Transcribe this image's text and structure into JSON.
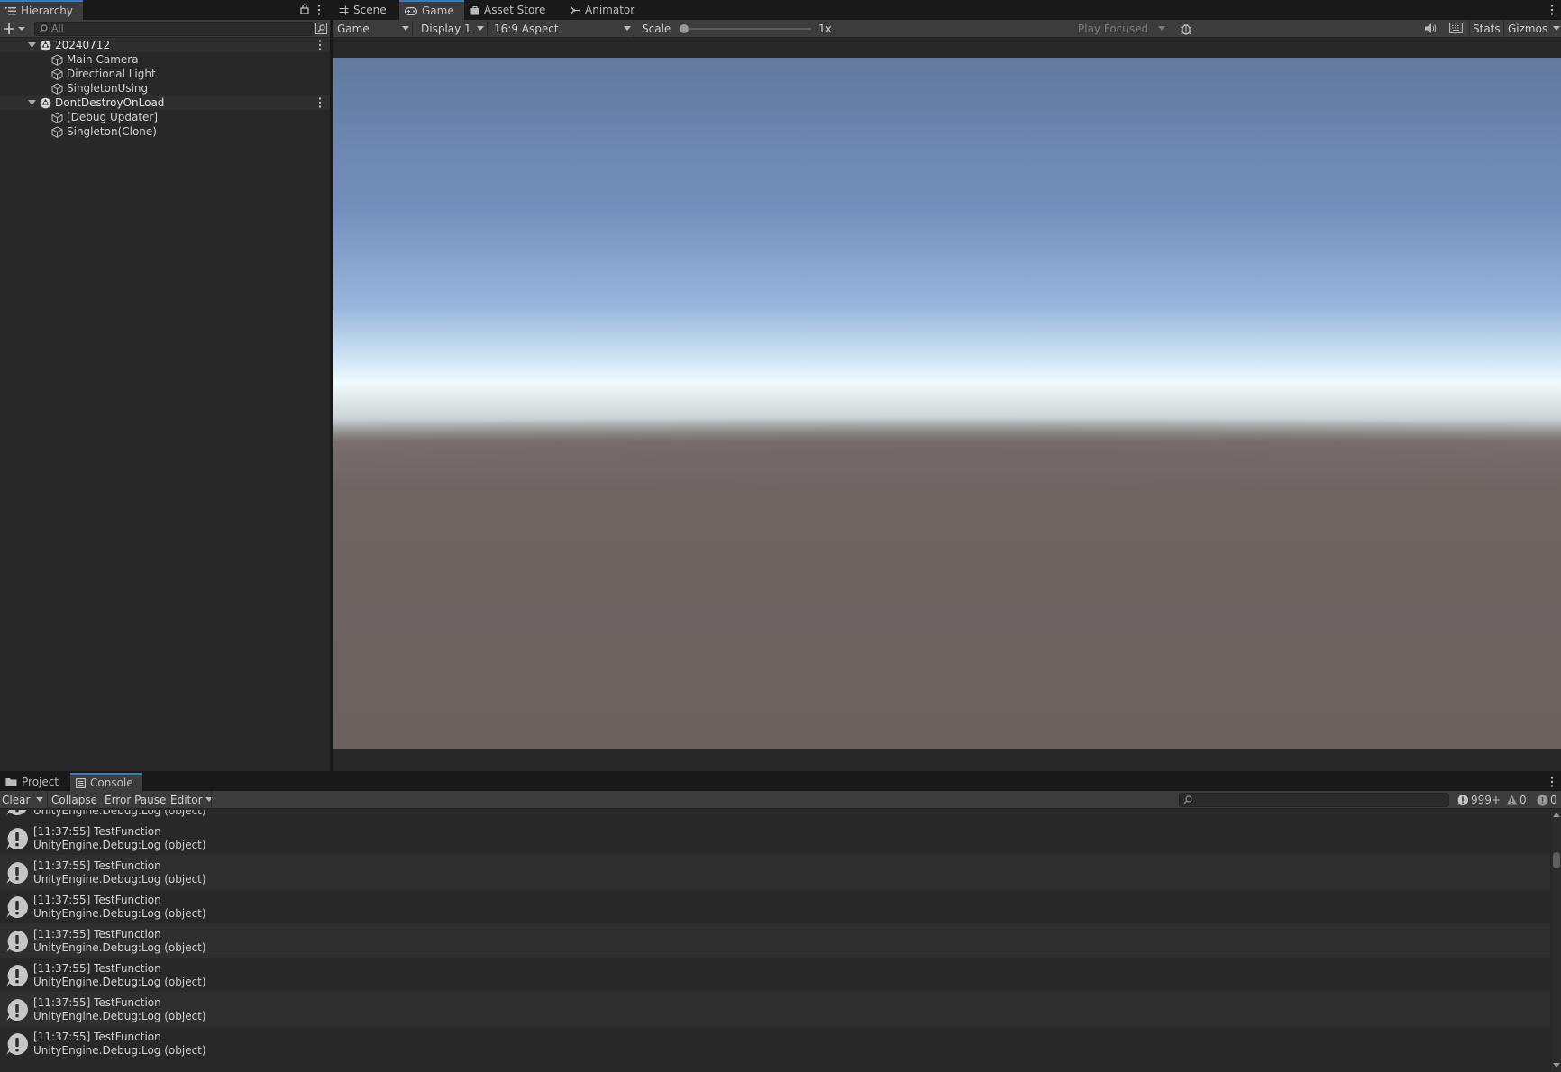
{
  "hierarchy": {
    "tab_label": "Hierarchy",
    "search_placeholder": "All",
    "rows": [
      {
        "label": "20240712"
      },
      {
        "label": "Main Camera"
      },
      {
        "label": "Directional Light"
      },
      {
        "label": "SingletonUsing"
      },
      {
        "label": "DontDestroyOnLoad"
      },
      {
        "label": "[Debug Updater]"
      },
      {
        "label": "Singleton(Clone)"
      }
    ]
  },
  "center_tabs": [
    {
      "label": "Scene",
      "icon": "hash-icon"
    },
    {
      "label": "Game",
      "icon": "gamepad-icon"
    },
    {
      "label": "Asset Store",
      "icon": "bag-icon"
    },
    {
      "label": "Animator",
      "icon": "animator-icon"
    }
  ],
  "game_toolbar": {
    "game_mode": "Game",
    "display": "Display 1",
    "aspect": "16:9 Aspect",
    "scale_label": "Scale",
    "scale_value": "1x",
    "scale_level": 0.0,
    "play_focus": "Play Focused",
    "stats": "Stats",
    "gizmos": "Gizmos"
  },
  "bottom_tabs": [
    {
      "label": "Project",
      "icon": "folder-icon"
    },
    {
      "label": "Console",
      "icon": "console-icon"
    }
  ],
  "console_toolbar": {
    "clear": "Clear",
    "collapse": "Collapse",
    "error_pause": "Error Pause",
    "editor": "Editor",
    "log_count": "999+",
    "warning_count": "0",
    "error_count": "0"
  },
  "console": {
    "partial_row_text": "UnityEngine.Debug:Log (object)",
    "entries": [
      {
        "line1": "[11:37:55] TestFunction",
        "line2": "UnityEngine.Debug:Log (object)"
      },
      {
        "line1": "[11:37:55] TestFunction",
        "line2": "UnityEngine.Debug:Log (object)"
      },
      {
        "line1": "[11:37:55] TestFunction",
        "line2": "UnityEngine.Debug:Log (object)"
      },
      {
        "line1": "[11:37:55] TestFunction",
        "line2": "UnityEngine.Debug:Log (object)"
      },
      {
        "line1": "[11:37:55] TestFunction",
        "line2": "UnityEngine.Debug:Log (object)"
      },
      {
        "line1": "[11:37:55] TestFunction",
        "line2": "UnityEngine.Debug:Log (object)"
      },
      {
        "line1": "[11:37:55] TestFunction",
        "line2": "UnityEngine.Debug:Log (object)"
      }
    ]
  },
  "colors": {
    "panel": "#282828",
    "toolbar": "#3c3c3c",
    "tab_highlight": "#3a79bb",
    "sky_top": "#63799f",
    "horizon": "#f0fafc",
    "ground": "#6b6260"
  }
}
